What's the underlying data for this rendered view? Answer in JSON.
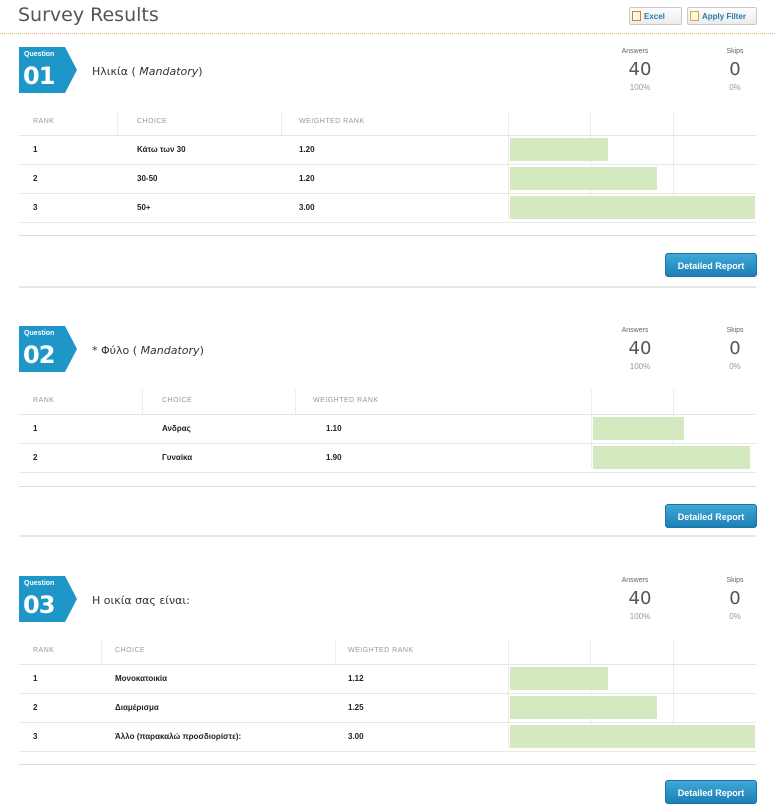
{
  "page_title": "Survey Results",
  "toolbar": {
    "excel_label": "Excel",
    "apply_filter_label": "Apply Filter"
  },
  "labels": {
    "question": "Question",
    "answers": "Answers",
    "skips": "Skips",
    "detailed_report": "Detailed Report",
    "col_rank": "RANK",
    "col_choice": "CHOICE",
    "col_weighted_rank": "WEIGHTED RANK"
  },
  "questions": [
    {
      "number": "01",
      "title": "Ηλικία",
      "mandatory": "Mandatory",
      "answers": "40",
      "answers_pct": "100%",
      "skips": "0",
      "skips_pct": "0%",
      "rows": [
        {
          "rank": "1",
          "choice": "Κάτω των 30",
          "weighted_rank": "1.20",
          "bar_fraction": 0.4
        },
        {
          "rank": "2",
          "choice": "30-50",
          "weighted_rank": "1.20",
          "bar_fraction": 0.6
        },
        {
          "rank": "3",
          "choice": "50+",
          "weighted_rank": "3.00",
          "bar_fraction": 1.0
        }
      ]
    },
    {
      "number": "02",
      "title": "* Φύλο",
      "mandatory": "Mandatory",
      "answers": "40",
      "answers_pct": "100%",
      "skips": "0",
      "skips_pct": "0%",
      "rows": [
        {
          "rank": "1",
          "choice": "Ανδρας",
          "weighted_rank": "1.10",
          "bar_fraction": 0.56
        },
        {
          "rank": "2",
          "choice": "Γυναίκα",
          "weighted_rank": "1.90",
          "bar_fraction": 0.97
        }
      ]
    },
    {
      "number": "03",
      "title": "Η οικία σας είναι:",
      "mandatory": "",
      "answers": "40",
      "answers_pct": "100%",
      "skips": "0",
      "skips_pct": "0%",
      "rows": [
        {
          "rank": "1",
          "choice": "Μονοκατοικία",
          "weighted_rank": "1.12",
          "bar_fraction": 0.4
        },
        {
          "rank": "2",
          "choice": "Διαμέρισμα",
          "weighted_rank": "1.25",
          "bar_fraction": 0.6
        },
        {
          "rank": "3",
          "choice": "Άλλο (παρακαλώ προσδιορίστε):",
          "weighted_rank": "3.00",
          "bar_fraction": 1.0
        }
      ]
    }
  ],
  "colors": {
    "accent": "#1e96c8",
    "bar": "#d4e9c0",
    "button": "#2b93c8"
  }
}
